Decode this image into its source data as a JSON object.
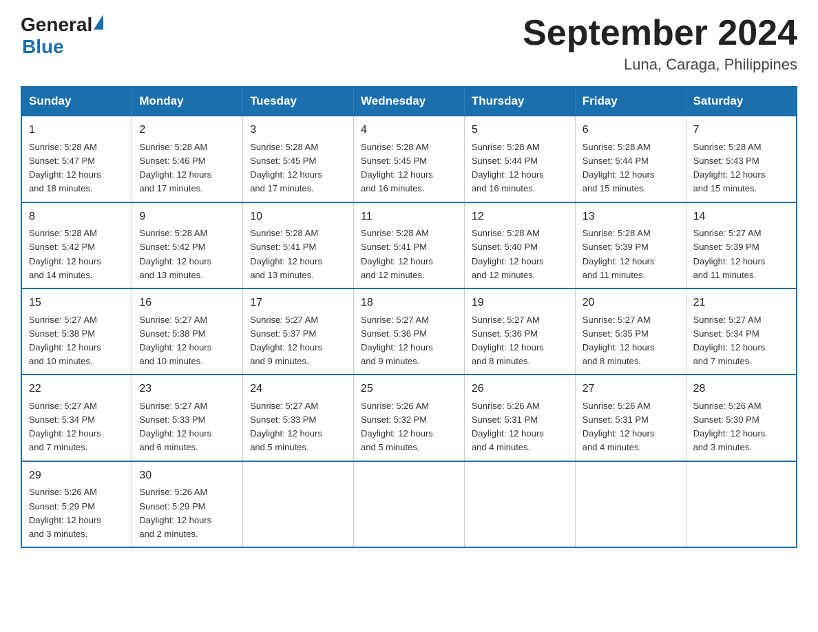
{
  "header": {
    "logo_general": "General",
    "logo_blue": "Blue",
    "title": "September 2024",
    "subtitle": "Luna, Caraga, Philippines"
  },
  "weekdays": [
    "Sunday",
    "Monday",
    "Tuesday",
    "Wednesday",
    "Thursday",
    "Friday",
    "Saturday"
  ],
  "weeks": [
    [
      {
        "day": "1",
        "sunrise": "5:28 AM",
        "sunset": "5:47 PM",
        "daylight": "12 hours and 18 minutes."
      },
      {
        "day": "2",
        "sunrise": "5:28 AM",
        "sunset": "5:46 PM",
        "daylight": "12 hours and 17 minutes."
      },
      {
        "day": "3",
        "sunrise": "5:28 AM",
        "sunset": "5:45 PM",
        "daylight": "12 hours and 17 minutes."
      },
      {
        "day": "4",
        "sunrise": "5:28 AM",
        "sunset": "5:45 PM",
        "daylight": "12 hours and 16 minutes."
      },
      {
        "day": "5",
        "sunrise": "5:28 AM",
        "sunset": "5:44 PM",
        "daylight": "12 hours and 16 minutes."
      },
      {
        "day": "6",
        "sunrise": "5:28 AM",
        "sunset": "5:44 PM",
        "daylight": "12 hours and 15 minutes."
      },
      {
        "day": "7",
        "sunrise": "5:28 AM",
        "sunset": "5:43 PM",
        "daylight": "12 hours and 15 minutes."
      }
    ],
    [
      {
        "day": "8",
        "sunrise": "5:28 AM",
        "sunset": "5:42 PM",
        "daylight": "12 hours and 14 minutes."
      },
      {
        "day": "9",
        "sunrise": "5:28 AM",
        "sunset": "5:42 PM",
        "daylight": "12 hours and 13 minutes."
      },
      {
        "day": "10",
        "sunrise": "5:28 AM",
        "sunset": "5:41 PM",
        "daylight": "12 hours and 13 minutes."
      },
      {
        "day": "11",
        "sunrise": "5:28 AM",
        "sunset": "5:41 PM",
        "daylight": "12 hours and 12 minutes."
      },
      {
        "day": "12",
        "sunrise": "5:28 AM",
        "sunset": "5:40 PM",
        "daylight": "12 hours and 12 minutes."
      },
      {
        "day": "13",
        "sunrise": "5:28 AM",
        "sunset": "5:39 PM",
        "daylight": "12 hours and 11 minutes."
      },
      {
        "day": "14",
        "sunrise": "5:27 AM",
        "sunset": "5:39 PM",
        "daylight": "12 hours and 11 minutes."
      }
    ],
    [
      {
        "day": "15",
        "sunrise": "5:27 AM",
        "sunset": "5:38 PM",
        "daylight": "12 hours and 10 minutes."
      },
      {
        "day": "16",
        "sunrise": "5:27 AM",
        "sunset": "5:38 PM",
        "daylight": "12 hours and 10 minutes."
      },
      {
        "day": "17",
        "sunrise": "5:27 AM",
        "sunset": "5:37 PM",
        "daylight": "12 hours and 9 minutes."
      },
      {
        "day": "18",
        "sunrise": "5:27 AM",
        "sunset": "5:36 PM",
        "daylight": "12 hours and 9 minutes."
      },
      {
        "day": "19",
        "sunrise": "5:27 AM",
        "sunset": "5:36 PM",
        "daylight": "12 hours and 8 minutes."
      },
      {
        "day": "20",
        "sunrise": "5:27 AM",
        "sunset": "5:35 PM",
        "daylight": "12 hours and 8 minutes."
      },
      {
        "day": "21",
        "sunrise": "5:27 AM",
        "sunset": "5:34 PM",
        "daylight": "12 hours and 7 minutes."
      }
    ],
    [
      {
        "day": "22",
        "sunrise": "5:27 AM",
        "sunset": "5:34 PM",
        "daylight": "12 hours and 7 minutes."
      },
      {
        "day": "23",
        "sunrise": "5:27 AM",
        "sunset": "5:33 PM",
        "daylight": "12 hours and 6 minutes."
      },
      {
        "day": "24",
        "sunrise": "5:27 AM",
        "sunset": "5:33 PM",
        "daylight": "12 hours and 5 minutes."
      },
      {
        "day": "25",
        "sunrise": "5:26 AM",
        "sunset": "5:32 PM",
        "daylight": "12 hours and 5 minutes."
      },
      {
        "day": "26",
        "sunrise": "5:26 AM",
        "sunset": "5:31 PM",
        "daylight": "12 hours and 4 minutes."
      },
      {
        "day": "27",
        "sunrise": "5:26 AM",
        "sunset": "5:31 PM",
        "daylight": "12 hours and 4 minutes."
      },
      {
        "day": "28",
        "sunrise": "5:26 AM",
        "sunset": "5:30 PM",
        "daylight": "12 hours and 3 minutes."
      }
    ],
    [
      {
        "day": "29",
        "sunrise": "5:26 AM",
        "sunset": "5:29 PM",
        "daylight": "12 hours and 3 minutes."
      },
      {
        "day": "30",
        "sunrise": "5:26 AM",
        "sunset": "5:29 PM",
        "daylight": "12 hours and 2 minutes."
      },
      null,
      null,
      null,
      null,
      null
    ]
  ]
}
